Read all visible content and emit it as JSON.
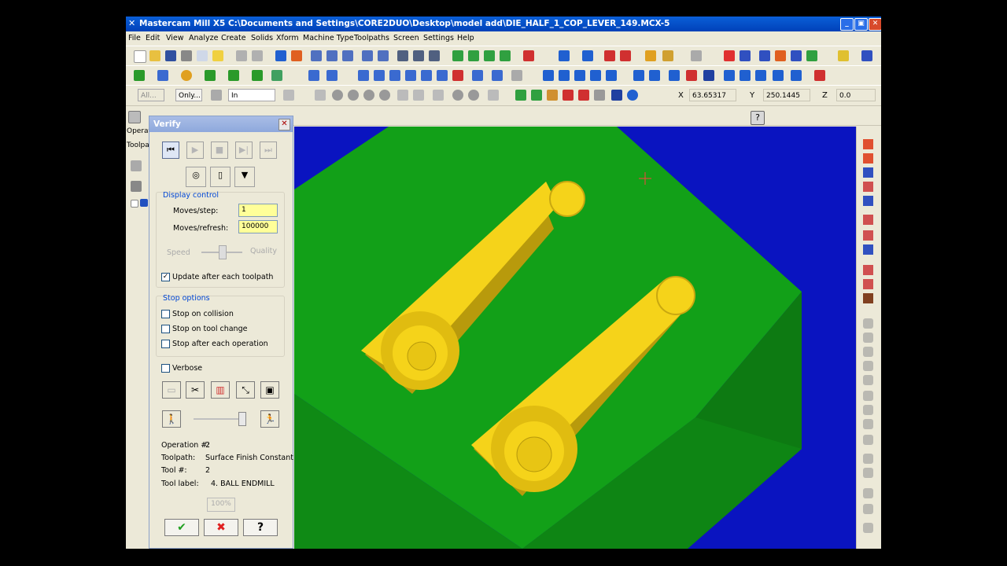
{
  "window": {
    "title": "Mastercam Mill X5  C:\\Documents and Settings\\CORE2DUO\\Desktop\\model add\\DIE_HALF_1_COP_LEVER_149.MCX-5"
  },
  "menu": [
    "File",
    "Edit",
    "View",
    "Analyze",
    "Create",
    "Solids",
    "Xform",
    "Machine Type",
    "Toolpaths",
    "Screen",
    "Settings",
    "Help"
  ],
  "toolbar3": {
    "all_label": "All...",
    "only_label": "Only...",
    "units_value": "In",
    "x_label": "X",
    "x_value": "63.65317",
    "y_label": "Y",
    "y_value": "250.1445",
    "z_label": "Z",
    "z_value": "0.0"
  },
  "left_panel": {
    "tab1": "Operat",
    "tab2": "Toolpa"
  },
  "verify": {
    "title": "Verify",
    "display_control_label": "Display control",
    "moves_step_label": "Moves/step:",
    "moves_step_value": "1",
    "moves_refresh_label": "Moves/refresh:",
    "moves_refresh_value": "100000",
    "speed_label": "Speed",
    "quality_label": "Quality",
    "update_label": "Update after each toolpath",
    "update_checked": true,
    "stop_options_label": "Stop options",
    "stop_collision_label": "Stop on collision",
    "stop_toolchange_label": "Stop on tool change",
    "stop_operation_label": "Stop after each operation",
    "verbose_label": "Verbose",
    "operation_label": "Operation #:",
    "operation_value": "2",
    "toolpath_label": "Toolpath:",
    "toolpath_value": "Surface Finish Constant",
    "tool_label": "Tool #:",
    "tool_value": "2",
    "tool_label_label": "Tool label:",
    "tool_label_value": "4. BALL ENDMILL",
    "progress_text": "100%"
  },
  "colors": {
    "viewport_bg": "#0a14c0",
    "stock_green": "#12a018",
    "part_yellow": "#f5d31a",
    "titlebar_blue": "#0a5fd8"
  }
}
